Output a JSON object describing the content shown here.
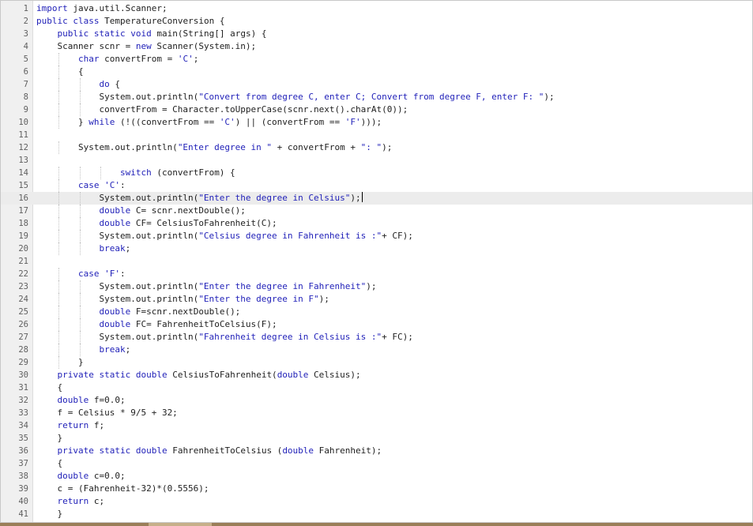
{
  "editor": {
    "current_line": 16,
    "lines": [
      {
        "n": "1",
        "text": "import java.util.Scanner;"
      },
      {
        "n": "2",
        "text": "public class TemperatureConversion {"
      },
      {
        "n": "3",
        "text": "    public static void main(String[] args) {"
      },
      {
        "n": "4",
        "text": "    Scanner scnr = new Scanner(System.in);"
      },
      {
        "n": "5",
        "text": "        char convertFrom = 'C';"
      },
      {
        "n": "6",
        "text": "        {"
      },
      {
        "n": "7",
        "text": "            do {"
      },
      {
        "n": "8",
        "text": "            System.out.println(\"Convert from degree C, enter C; Convert from degree F, enter F: \");"
      },
      {
        "n": "9",
        "text": "            convertFrom = Character.toUpperCase(scnr.next().charAt(0));"
      },
      {
        "n": "10",
        "text": "        } while (!((convertFrom == 'C') || (convertFrom == 'F')));"
      },
      {
        "n": "11",
        "text": ""
      },
      {
        "n": "12",
        "text": "        System.out.println(\"Enter degree in \" + convertFrom + \": \");"
      },
      {
        "n": "13",
        "text": ""
      },
      {
        "n": "14",
        "text": "                switch (convertFrom) {"
      },
      {
        "n": "15",
        "text": "        case 'C':"
      },
      {
        "n": "16",
        "text": "            System.out.println(\"Enter the degree in Celsius\");"
      },
      {
        "n": "17",
        "text": "            double C= scnr.nextDouble();"
      },
      {
        "n": "18",
        "text": "            double CF= CelsiusToFahrenheit(C);"
      },
      {
        "n": "19",
        "text": "            System.out.println(\"Celsius degree in Fahrenheit is :\"+ CF);"
      },
      {
        "n": "20",
        "text": "            break;"
      },
      {
        "n": "21",
        "text": ""
      },
      {
        "n": "22",
        "text": "        case 'F':"
      },
      {
        "n": "23",
        "text": "            System.out.println(\"Enter the degree in Fahrenheit\");"
      },
      {
        "n": "24",
        "text": "            System.out.println(\"Enter the degree in F\");"
      },
      {
        "n": "25",
        "text": "            double F=scnr.nextDouble();"
      },
      {
        "n": "26",
        "text": "            double FC= FahrenheitToCelsius(F);"
      },
      {
        "n": "27",
        "text": "            System.out.println(\"Fahrenheit degree in Celsius is :\"+ FC);"
      },
      {
        "n": "28",
        "text": "            break;"
      },
      {
        "n": "29",
        "text": "        }"
      },
      {
        "n": "30",
        "text": "    private static double CelsiusToFahrenheit(double Celsius);"
      },
      {
        "n": "31",
        "text": "    {"
      },
      {
        "n": "32",
        "text": "    double f=0.0;"
      },
      {
        "n": "33",
        "text": "    f = Celsius * 9/5 + 32;"
      },
      {
        "n": "34",
        "text": "    return f;"
      },
      {
        "n": "35",
        "text": "    }"
      },
      {
        "n": "36",
        "text": "    private static double FahrenheitToCelsius (double Fahrenheit);"
      },
      {
        "n": "37",
        "text": "    {"
      },
      {
        "n": "38",
        "text": "    double c=0.0;"
      },
      {
        "n": "39",
        "text": "    c = (Fahrenheit-32)*(0.5556);"
      },
      {
        "n": "40",
        "text": "    return c;"
      },
      {
        "n": "41",
        "text": "    }"
      }
    ]
  },
  "colors": {
    "keyword": "#1f1fb8",
    "string": "#1f1fb8",
    "char_literal": "#1f1fb8",
    "plain": "#1e1e1e",
    "line_number": "#606060",
    "gutter_bg": "#f0f0f0",
    "current_line_bg": "#ececec"
  }
}
